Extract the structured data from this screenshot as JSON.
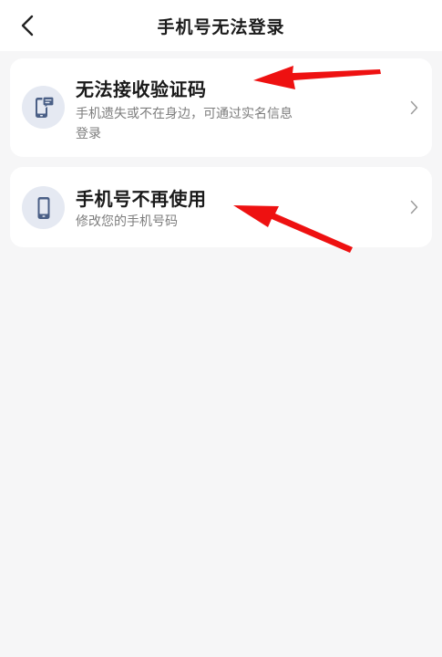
{
  "header": {
    "title": "手机号无法登录",
    "back_icon": "chevron-left-icon"
  },
  "options": [
    {
      "title": "无法接收验证码",
      "description": "手机遗失或不在身边，可通过实名信息登录",
      "icon": "phone-message-icon"
    },
    {
      "title": "手机号不再使用",
      "description": "修改您的手机号码",
      "icon": "phone-icon"
    }
  ],
  "colors": {
    "background": "#f6f6f7",
    "card": "#ffffff",
    "icon_circle": "#e5e9f2",
    "icon_fill": "#4a5f86",
    "annotation_arrow": "#ee1111"
  }
}
